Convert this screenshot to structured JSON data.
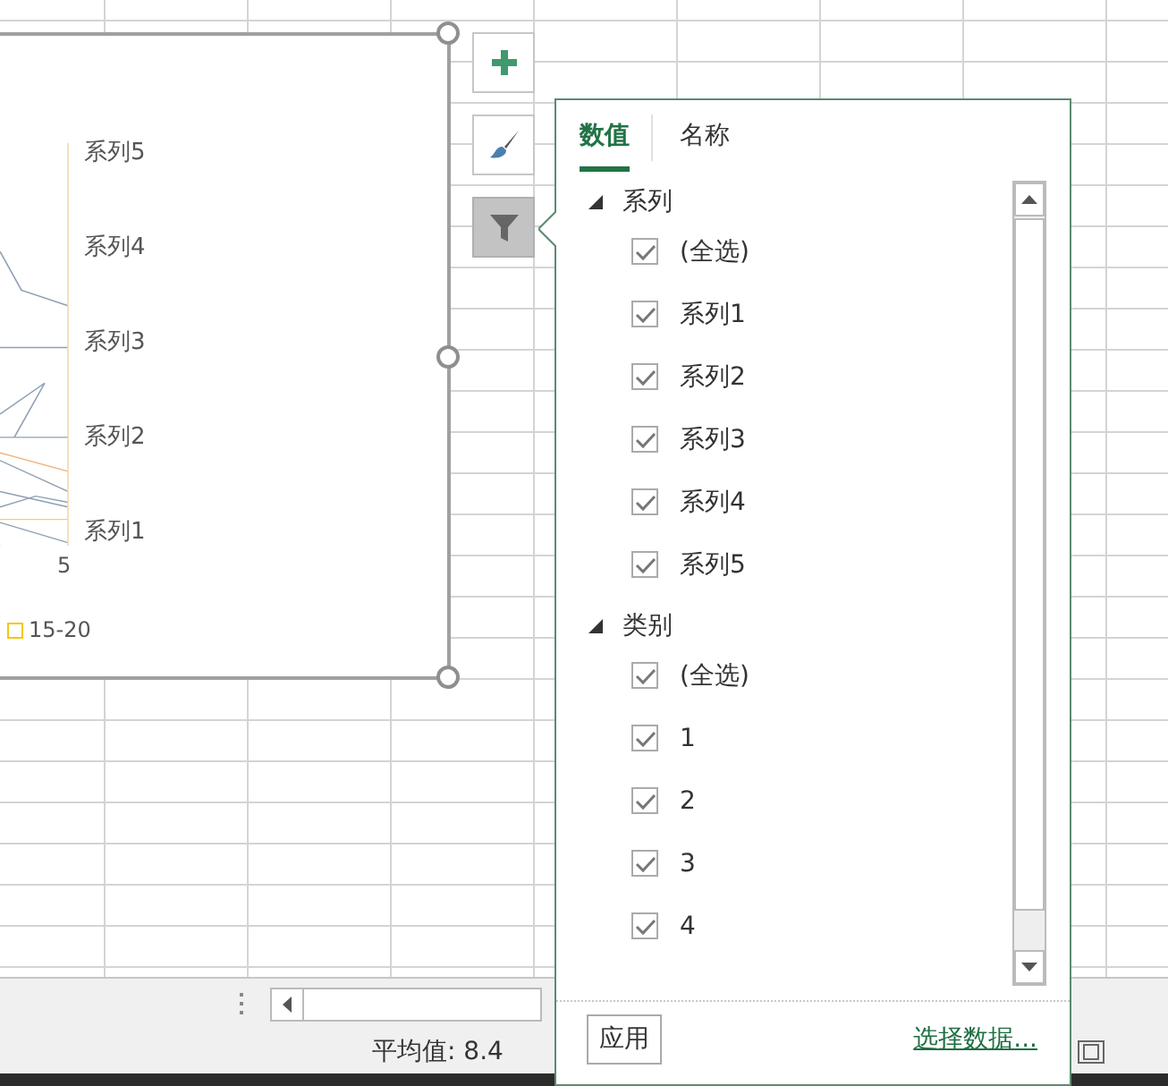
{
  "chart": {
    "axis_labels": [
      "系列5",
      "系列4",
      "系列3",
      "系列2",
      "系列1"
    ],
    "x_label": "5",
    "legend": [
      {
        "label": "15-20",
        "color": "#f2c811"
      }
    ]
  },
  "chart_buttons": [
    {
      "kind": "plus",
      "selected": false
    },
    {
      "kind": "brush",
      "selected": false
    },
    {
      "kind": "filter",
      "selected": true
    }
  ],
  "filter_panel": {
    "tabs": [
      {
        "label": "数值",
        "selected": true
      },
      {
        "label": "名称",
        "selected": false
      }
    ],
    "groups": [
      {
        "label": "系列",
        "expanded": true,
        "children": [
          {
            "label": "(全选)",
            "checked": true
          },
          {
            "label": "系列1",
            "checked": true
          },
          {
            "label": "系列2",
            "checked": true
          },
          {
            "label": "系列3",
            "checked": true
          },
          {
            "label": "系列4",
            "checked": true
          },
          {
            "label": "系列5",
            "checked": true
          }
        ]
      },
      {
        "label": "类别",
        "expanded": true,
        "children": [
          {
            "label": "(全选)",
            "checked": true
          },
          {
            "label": "1",
            "checked": true
          },
          {
            "label": "2",
            "checked": true
          },
          {
            "label": "3",
            "checked": true
          },
          {
            "label": "4",
            "checked": true
          }
        ]
      }
    ],
    "apply_button": "应用",
    "link": "选择数据..."
  },
  "status_bar": {
    "average": "平均值: 8.4"
  }
}
